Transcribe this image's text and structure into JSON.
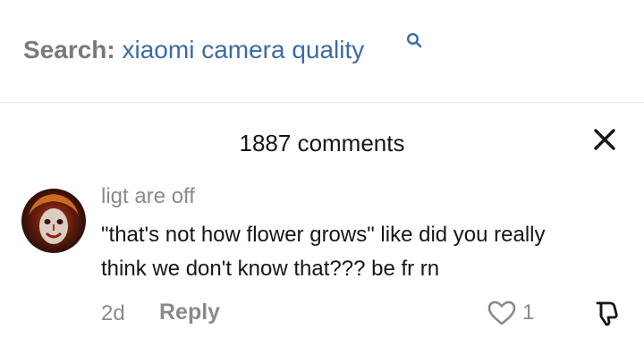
{
  "search": {
    "label": "Search:",
    "query": "xiaomi camera quality",
    "icon": "search-icon"
  },
  "comments_panel": {
    "title": "1887 comments",
    "close_icon": "close-icon"
  },
  "comment": {
    "avatar_icon": "avatar",
    "username": "ligt are off",
    "text_line1": "\"that's not how flower grows\" like did you really",
    "text_line2": "think we don't know that??? be fr rn",
    "time": "2d",
    "reply_label": "Reply",
    "like_icon": "heart-outline-icon",
    "like_count": "1",
    "dislike_icon": "thumbs-down-icon"
  },
  "colors": {
    "query_blue": "#3b6ba8",
    "gray_text": "#8a8a8a",
    "dark_text": "#161616"
  }
}
